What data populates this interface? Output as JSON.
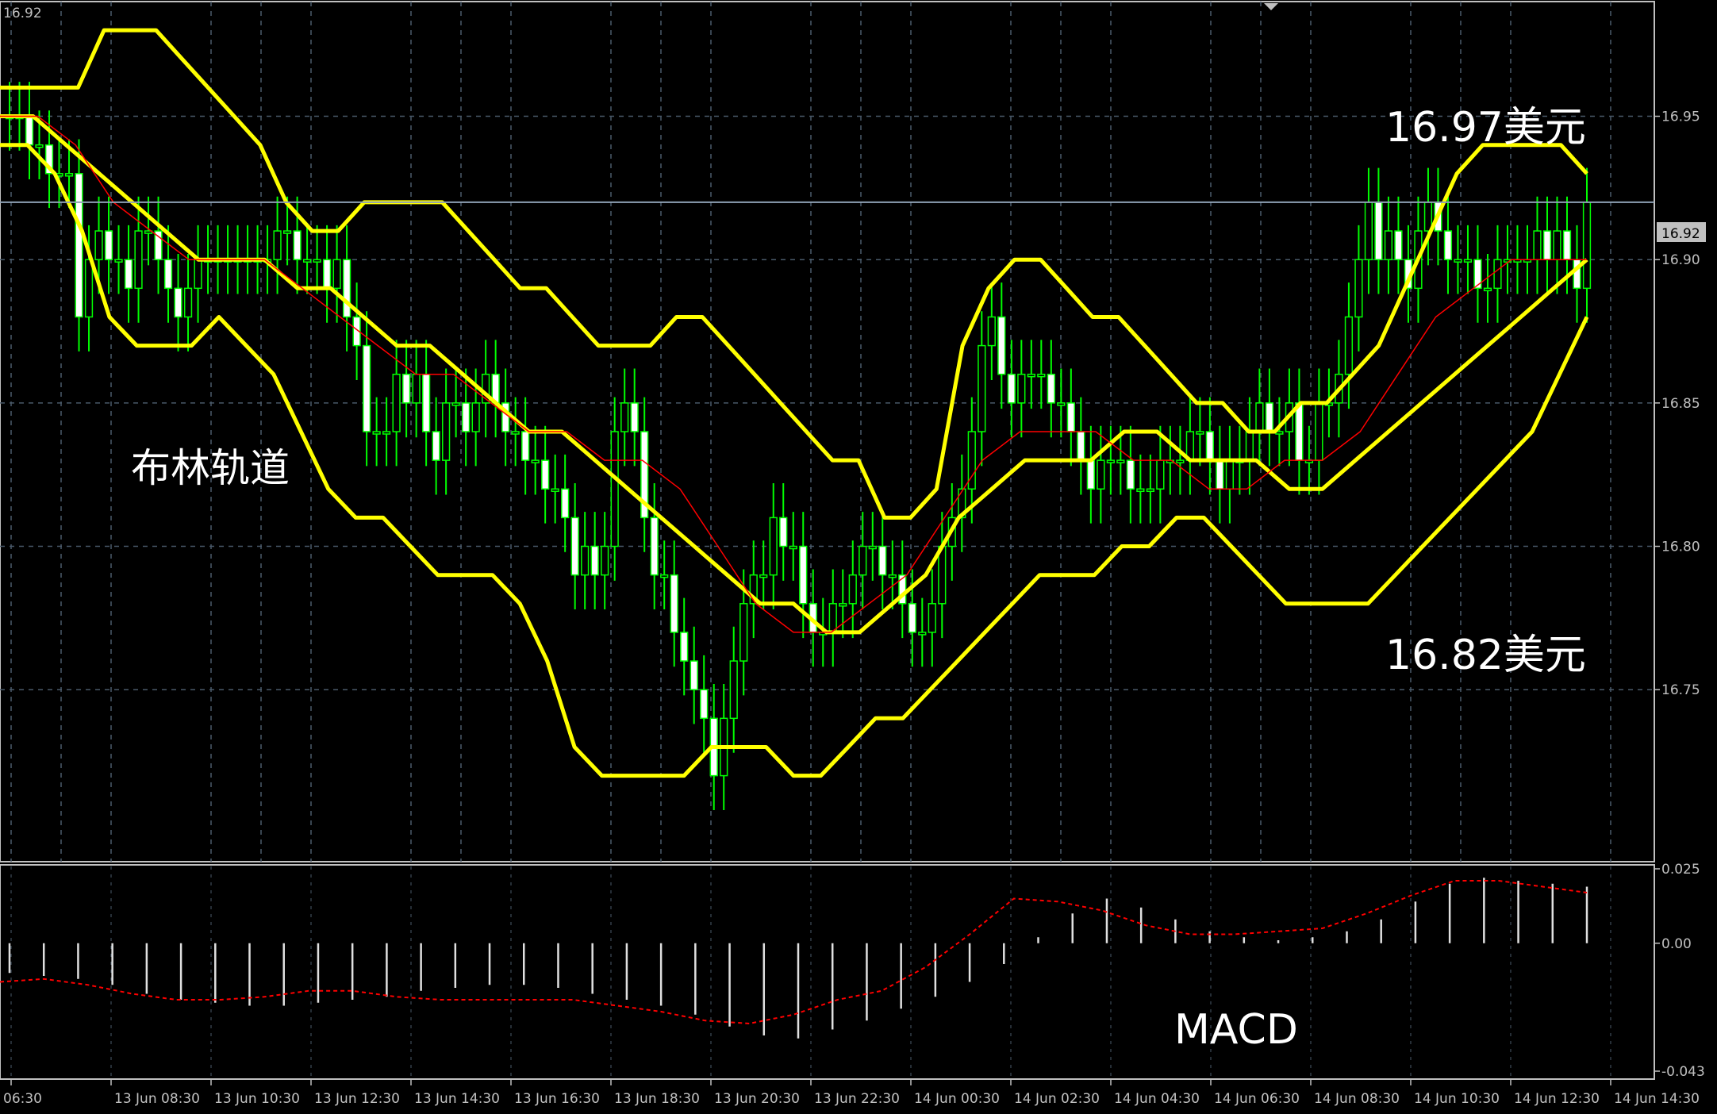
{
  "chart_data": [
    {
      "type": "candlestick",
      "panel": "main",
      "ylim": [
        16.69,
        16.99
      ],
      "y_ticks": [
        "16.95",
        "16.90",
        "16.85",
        "16.80",
        "16.75"
      ],
      "current_price": "16.92",
      "corner_price": "16.92",
      "colors": {
        "candle": "#00ff00",
        "bands": "#ffff00",
        "ma": "#ff0000",
        "grid": "#4a5a6a",
        "frame": "#c0c0c0"
      },
      "series": [
        {
          "name": "price",
          "values": [
            16.95,
            16.95,
            16.94,
            16.94,
            16.93,
            16.93,
            16.93,
            16.88,
            16.9,
            16.91,
            16.9,
            16.9,
            16.89,
            16.91,
            16.91,
            16.9,
            16.89,
            16.88,
            16.89,
            16.9,
            16.9,
            16.9,
            16.9,
            16.9,
            16.9,
            16.9,
            16.9,
            16.91,
            16.91,
            16.9,
            16.9,
            16.9,
            16.89,
            16.9,
            16.88,
            16.87,
            16.84,
            16.84,
            16.84,
            16.86,
            16.85,
            16.86,
            16.84,
            16.83,
            16.85,
            16.85,
            16.84,
            16.85,
            16.86,
            16.85,
            16.84,
            16.84,
            16.83,
            16.83,
            16.82,
            16.82,
            16.81,
            16.79,
            16.8,
            16.79,
            16.8,
            16.84,
            16.85,
            16.84,
            16.81,
            16.79,
            16.79,
            16.77,
            16.76,
            16.75,
            16.74,
            16.72,
            16.74,
            16.76,
            16.78,
            16.79,
            16.79,
            16.81,
            16.8,
            16.8,
            16.78,
            16.77,
            16.77,
            16.78,
            16.78,
            16.79,
            16.8,
            16.8,
            16.79,
            16.79,
            16.78,
            16.77,
            16.77,
            16.78,
            16.8,
            16.81,
            16.82,
            16.84,
            16.87,
            16.88,
            16.86,
            16.85,
            16.86,
            16.86,
            16.86,
            16.85,
            16.85,
            16.84,
            16.83,
            16.82,
            16.83,
            16.83,
            16.83,
            16.82,
            16.82,
            16.82,
            16.83,
            16.83,
            16.83,
            16.84,
            16.84,
            16.83,
            16.82,
            16.83,
            16.83,
            16.84,
            16.85,
            16.84,
            16.84,
            16.85,
            16.83,
            16.83,
            16.85,
            16.85,
            16.86,
            16.88,
            16.9,
            16.92,
            16.9,
            16.91,
            16.9,
            16.89,
            16.91,
            16.92,
            16.91,
            16.9,
            16.9,
            16.9,
            16.89,
            16.89,
            16.9,
            16.9,
            16.9,
            16.9,
            16.91,
            16.9,
            16.91,
            16.9,
            16.89,
            16.92
          ]
        },
        {
          "name": "upper_band",
          "values": [
            16.96,
            16.96,
            16.96,
            16.96,
            16.98,
            16.98,
            16.98,
            16.97,
            16.96,
            16.95,
            16.94,
            16.92,
            16.91,
            16.91,
            16.92,
            16.92,
            16.92,
            16.92,
            16.91,
            16.9,
            16.89,
            16.89,
            16.88,
            16.87,
            16.87,
            16.87,
            16.88,
            16.88,
            16.87,
            16.86,
            16.85,
            16.84,
            16.83,
            16.83,
            16.81,
            16.81,
            16.82,
            16.87,
            16.89,
            16.9,
            16.9,
            16.89,
            16.88,
            16.88,
            16.87,
            16.86,
            16.85,
            16.85,
            16.84,
            16.84,
            16.85,
            16.85,
            16.86,
            16.87,
            16.89,
            16.91,
            16.93,
            16.94,
            16.94,
            16.94,
            16.94,
            16.93
          ]
        },
        {
          "name": "lower_band",
          "values": [
            16.94,
            16.94,
            16.93,
            16.91,
            16.88,
            16.87,
            16.87,
            16.87,
            16.88,
            16.87,
            16.86,
            16.84,
            16.82,
            16.81,
            16.81,
            16.8,
            16.79,
            16.79,
            16.79,
            16.78,
            16.76,
            16.73,
            16.72,
            16.72,
            16.72,
            16.72,
            16.73,
            16.73,
            16.73,
            16.72,
            16.72,
            16.73,
            16.74,
            16.74,
            16.75,
            16.76,
            16.77,
            16.78,
            16.79,
            16.79,
            16.79,
            16.8,
            16.8,
            16.81,
            16.81,
            16.8,
            16.79,
            16.78,
            16.78,
            16.78,
            16.78,
            16.79,
            16.8,
            16.81,
            16.82,
            16.83,
            16.84,
            16.86,
            16.88
          ]
        },
        {
          "name": "middle_band",
          "values": [
            16.95,
            16.95,
            16.94,
            16.93,
            16.92,
            16.91,
            16.9,
            16.9,
            16.9,
            16.89,
            16.89,
            16.88,
            16.87,
            16.87,
            16.86,
            16.85,
            16.84,
            16.84,
            16.83,
            16.82,
            16.81,
            16.8,
            16.79,
            16.78,
            16.78,
            16.77,
            16.77,
            16.78,
            16.79,
            16.81,
            16.82,
            16.83,
            16.83,
            16.83,
            16.84,
            16.84,
            16.83,
            16.83,
            16.83,
            16.82,
            16.82,
            16.83,
            16.84,
            16.85,
            16.86,
            16.87,
            16.88,
            16.89,
            16.9
          ]
        },
        {
          "name": "ma",
          "values": [
            16.95,
            16.95,
            16.94,
            16.92,
            16.91,
            16.9,
            16.9,
            16.9,
            16.89,
            16.88,
            16.87,
            16.86,
            16.86,
            16.85,
            16.84,
            16.84,
            16.83,
            16.83,
            16.82,
            16.8,
            16.78,
            16.77,
            16.77,
            16.78,
            16.79,
            16.81,
            16.83,
            16.84,
            16.84,
            16.84,
            16.83,
            16.83,
            16.82,
            16.82,
            16.83,
            16.83,
            16.84,
            16.86,
            16.88,
            16.89,
            16.9,
            16.9,
            16.9
          ]
        }
      ],
      "annotations": {
        "band_label": "布林轨道",
        "upper_price": "16.97美元",
        "lower_price": "16.82美元"
      }
    },
    {
      "type": "bar",
      "panel": "macd",
      "ylim": [
        -0.043,
        0.025
      ],
      "y_ticks": [
        "0.025",
        "0.00",
        "-0.043"
      ],
      "label": "MACD",
      "series": [
        {
          "name": "histogram",
          "values": [
            -0.01,
            -0.011,
            -0.012,
            -0.014,
            -0.017,
            -0.019,
            -0.02,
            -0.021,
            -0.021,
            -0.02,
            -0.019,
            -0.018,
            -0.016,
            -0.015,
            -0.014,
            -0.014,
            -0.015,
            -0.017,
            -0.019,
            -0.021,
            -0.024,
            -0.028,
            -0.031,
            -0.032,
            -0.029,
            -0.026,
            -0.022,
            -0.018,
            -0.013,
            -0.007,
            0.002,
            0.01,
            0.015,
            0.012,
            0.008,
            0.004,
            0.002,
            0.001,
            0.002,
            0.004,
            0.008,
            0.014,
            0.02,
            0.022,
            0.021,
            0.02,
            0.019
          ]
        },
        {
          "name": "signal",
          "values": [
            -0.013,
            -0.012,
            -0.014,
            -0.017,
            -0.019,
            -0.019,
            -0.018,
            -0.016,
            -0.016,
            -0.018,
            -0.019,
            -0.019,
            -0.019,
            -0.019,
            -0.021,
            -0.023,
            -0.026,
            -0.027,
            -0.024,
            -0.019,
            -0.016,
            -0.008,
            0.003,
            0.015,
            0.014,
            0.011,
            0.006,
            0.003,
            0.003,
            0.004,
            0.005,
            0.01,
            0.016,
            0.021,
            0.021,
            0.019,
            0.017
          ]
        }
      ]
    },
    {
      "type": "axis",
      "panel": "time",
      "categories": [
        "06:30",
        "13 Jun 08:30",
        "13 Jun 10:30",
        "13 Jun 12:30",
        "13 Jun 14:30",
        "13 Jun 16:30",
        "13 Jun 18:30",
        "13 Jun 20:30",
        "13 Jun 22:30",
        "14 Jun 00:30",
        "14 Jun 02:30",
        "14 Jun 04:30",
        "14 Jun 06:30",
        "14 Jun 08:30",
        "14 Jun 10:30",
        "14 Jun 12:30",
        "14 Jun 14:30"
      ]
    }
  ]
}
